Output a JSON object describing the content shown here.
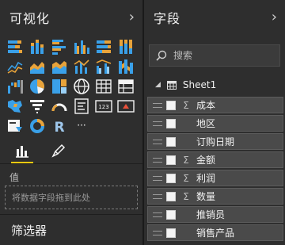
{
  "viz_pane": {
    "title": "可视化",
    "chevron": "›",
    "icons": [
      {
        "name": "stacked-bar-chart-icon"
      },
      {
        "name": "stacked-column-chart-icon"
      },
      {
        "name": "clustered-bar-chart-icon"
      },
      {
        "name": "clustered-column-chart-icon"
      },
      {
        "name": "100-stacked-bar-chart-icon"
      },
      {
        "name": "100-stacked-column-chart-icon"
      },
      {
        "name": "line-chart-icon"
      },
      {
        "name": "area-chart-icon"
      },
      {
        "name": "stacked-area-chart-icon"
      },
      {
        "name": "line-and-column-chart-icon"
      },
      {
        "name": "line-and-clustered-column-chart-icon"
      },
      {
        "name": "ribbon-chart-icon"
      },
      {
        "name": "waterfall-chart-icon"
      },
      {
        "name": "pie-chart-icon"
      },
      {
        "name": "treemap-icon"
      },
      {
        "name": "map-icon"
      },
      {
        "name": "table-icon"
      },
      {
        "name": "matrix-icon"
      },
      {
        "name": "filled-map-icon"
      },
      {
        "name": "funnel-icon"
      },
      {
        "name": "gauge-icon"
      },
      {
        "name": "multi-row-card-icon"
      },
      {
        "name": "card-icon"
      },
      {
        "name": "kpi-icon"
      },
      {
        "name": "slicer-icon"
      },
      {
        "name": "donut-chart-icon"
      },
      {
        "name": "r-visual-icon"
      },
      {
        "name": "more-visuals-icon"
      }
    ],
    "r_label": "R",
    "more_label": "···",
    "values_label": "值",
    "drop_placeholder": "将数据字段拖到此处",
    "filters_title": "筛选器",
    "accent": "#f2c811"
  },
  "fields_pane": {
    "title": "字段",
    "chevron": "›",
    "search_placeholder": "搜索",
    "table_name": "Sheet1",
    "fields": [
      {
        "label": "成本",
        "sigma": "Σ"
      },
      {
        "label": "地区",
        "sigma": ""
      },
      {
        "label": "订购日期",
        "sigma": ""
      },
      {
        "label": "金额",
        "sigma": "Σ"
      },
      {
        "label": "利润",
        "sigma": "Σ"
      },
      {
        "label": "数量",
        "sigma": "Σ"
      },
      {
        "label": "推销员",
        "sigma": ""
      },
      {
        "label": "销售产品",
        "sigma": ""
      }
    ]
  }
}
